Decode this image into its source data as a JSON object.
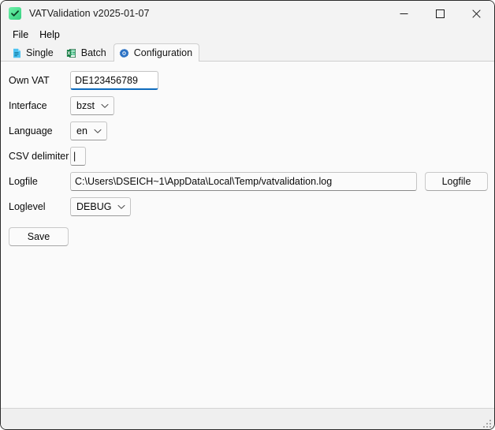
{
  "window": {
    "title": "VATValidation v2025-01-07",
    "app_icon": "check-badge-icon",
    "controls": {
      "minimize": "minimize-icon",
      "maximize": "maximize-icon",
      "close": "close-icon"
    }
  },
  "menu": {
    "items": [
      {
        "label": "File"
      },
      {
        "label": "Help"
      }
    ]
  },
  "tabs": [
    {
      "label": "Single",
      "icon": "document-icon",
      "active": false
    },
    {
      "label": "Batch",
      "icon": "spreadsheet-icon",
      "active": false
    },
    {
      "label": "Configuration",
      "icon": "gear-icon",
      "active": true
    }
  ],
  "form": {
    "own_vat": {
      "label": "Own VAT",
      "value": "DE123456789",
      "placeholder": "",
      "focused": true
    },
    "interface": {
      "label": "Interface",
      "value": "bzst",
      "options": [
        "bzst"
      ]
    },
    "language": {
      "label": "Language",
      "value": "en",
      "options": [
        "en"
      ]
    },
    "csv_delimiter": {
      "label": "CSV delimiter",
      "value": "|",
      "placeholder": ""
    },
    "logfile": {
      "label": "Logfile",
      "value": "C:\\Users\\DSEICH~1\\AppData\\Local\\Temp/vatvalidation.log",
      "placeholder": "",
      "button_label": "Logfile"
    },
    "loglevel": {
      "label": "Loglevel",
      "value": "DEBUG",
      "options": [
        "DEBUG"
      ]
    },
    "save_label": "Save"
  },
  "status_bar": {
    "text": "",
    "grip": "resize-grip-icon"
  },
  "colors": {
    "accent": "#0f6cbd",
    "window_bg": "#f3f3f3",
    "content_bg": "#fafafa",
    "status_bg": "#efefef",
    "icon_green": "#35d07f",
    "icon_blue": "#4cc2f1",
    "excel_green": "#1d7044"
  }
}
